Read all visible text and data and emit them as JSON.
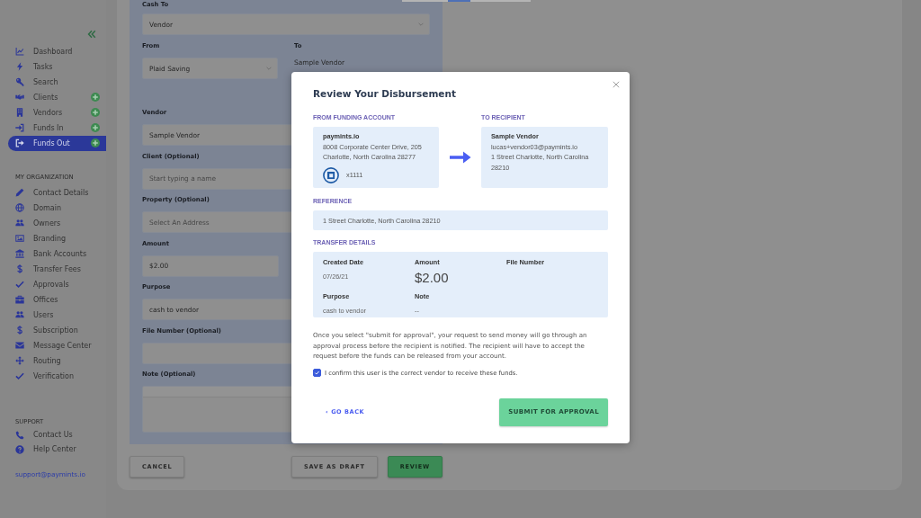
{
  "stepper": [
    {
      "selected": false
    },
    {
      "selected": true
    },
    {
      "selected": false
    }
  ],
  "sidebar": {
    "main_items": [
      {
        "label": "Dashboard",
        "selected": false,
        "add_button": false
      },
      {
        "label": "Tasks",
        "selected": false,
        "add_button": false
      },
      {
        "label": "Search",
        "selected": false,
        "add_button": false
      },
      {
        "label": "Clients",
        "selected": false,
        "add_button": true
      },
      {
        "label": "Vendors",
        "selected": false,
        "add_button": true
      },
      {
        "label": "Funds In",
        "selected": false,
        "add_button": true
      },
      {
        "label": "Funds Out",
        "selected": true,
        "add_button": true
      }
    ],
    "organization": {
      "title": "MY ORGANIZATION",
      "items": [
        {
          "label": "Contact Details",
          "selected": false
        },
        {
          "label": "Domain",
          "selected": false
        },
        {
          "label": "Owners",
          "selected": false
        },
        {
          "label": "Branding",
          "selected": false
        },
        {
          "label": "Bank Accounts",
          "selected": false
        },
        {
          "label": "Transfer Fees",
          "selected": false
        },
        {
          "label": "Approvals",
          "selected": false
        },
        {
          "label": "Offices",
          "selected": false
        },
        {
          "label": "Users",
          "selected": false
        },
        {
          "label": "Subscription",
          "selected": false
        },
        {
          "label": "Message Center",
          "selected": false
        },
        {
          "label": "Routing",
          "selected": false
        },
        {
          "label": "Verification",
          "selected": false
        }
      ]
    },
    "support": {
      "title": "SUPPORT",
      "items": [
        {
          "label": "Contact Us",
          "selected": false
        },
        {
          "label": "Help Center",
          "selected": false
        }
      ]
    },
    "email": "support@paymints.io"
  },
  "form": {
    "cash_to": {
      "label": "Cash To",
      "value": "Vendor"
    },
    "from": {
      "label": "From",
      "value": "Plaid Saving"
    },
    "to": {
      "label": "To",
      "value": "Sample Vendor"
    },
    "fields": [
      {
        "label": "Vendor",
        "kind": "text",
        "value": "Sample Vendor"
      },
      {
        "label": "Client (Optional)",
        "kind": "text",
        "placeholder": "Start typing a name"
      },
      {
        "label": "Property (Optional)",
        "kind": "text",
        "placeholder": "Select An Address"
      },
      {
        "label": "Amount",
        "kind": "currency",
        "value": "$2.00"
      },
      {
        "label": "Purpose",
        "kind": "text",
        "value": "cash to vendor"
      },
      {
        "label": "File Number (Optional)",
        "kind": "text"
      },
      {
        "label": "Note (Optional)",
        "kind": "textarea"
      }
    ]
  },
  "actions": [
    {
      "label": "CANCEL",
      "kind": "secondary"
    },
    {
      "label": "SAVE AS DRAFT",
      "kind": "secondary"
    },
    {
      "label": "REVIEW",
      "kind": "primary"
    }
  ],
  "modal": {
    "title": "Review Your Disbursement",
    "from": {
      "heading": "FROM FUNDING ACCOUNT",
      "name": "paymints.io",
      "lines": [
        "8008 Corporate Center Drive, 205",
        "Charlotte, North Carolina 28277"
      ],
      "account": "x1111"
    },
    "to": {
      "heading": "TO RECIPIENT",
      "name": "Sample Vendor",
      "email": "lucas+vendor03@paymints.io",
      "address": "1 Street Charlotte, North Carolina 28210"
    },
    "reference": {
      "heading": "REFERENCE",
      "value": "1 Street Charlotte, North Carolina 28210"
    },
    "transfer": {
      "heading": "TRANSFER DETAILS",
      "items": [
        {
          "label": "Created Date",
          "kind": "text",
          "value": "07/26/21"
        },
        {
          "label": "Amount",
          "kind": "amount",
          "value": "$2.00"
        },
        {
          "label": "File Number"
        },
        {
          "label": "Purpose",
          "kind": "text",
          "value": "cash to vendor"
        },
        {
          "label": "Note",
          "kind": "text",
          "value": "--"
        }
      ]
    },
    "notice": "Once you select \"submit for approval\", your request to send money will go through an approval process before the recipient is notified. The recipient will have to accept the request before the funds can be released from your account.",
    "confirm": {
      "label": "I confirm this user is the correct vendor to receive these funds.",
      "checked": true
    },
    "back": "‹ GO BACK",
    "submit": "SUBMIT FOR APPROVAL"
  }
}
